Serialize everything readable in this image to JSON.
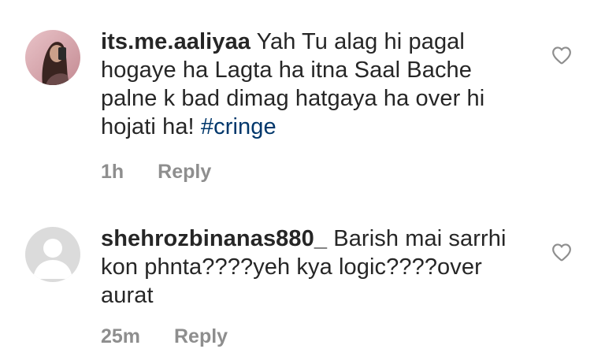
{
  "comments": [
    {
      "username": "its.me.aaliyaa",
      "text": "Yah Tu alag hi pagal hogaye ha Lagta ha itna Saal Bache palne k bad dimag hatgaya ha over hi hojati ha! ",
      "hashtag": "#cringe",
      "time": "1h",
      "reply_label": "Reply",
      "avatar_icon": "user-photo-avatar",
      "like_icon": "heart-outline-icon"
    },
    {
      "username": "shehrozbinanas880_",
      "text": "Barish mai sarrhi kon phnta????yeh kya logic????over aurat",
      "time": "25m",
      "reply_label": "Reply",
      "avatar_icon": "default-avatar",
      "like_icon": "heart-outline-icon"
    }
  ],
  "colors": {
    "text": "#262626",
    "secondary": "#8e8e8e",
    "hashtag": "#00376b",
    "background": "#ffffff"
  }
}
